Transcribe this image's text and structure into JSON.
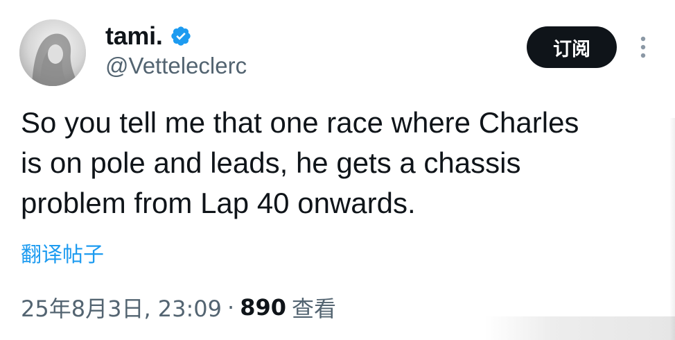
{
  "author": {
    "display_name": "tami.",
    "handle": "@Vetteleclerc",
    "verified": true,
    "avatar_icon": "avatar-portrait-icon",
    "verified_color": "#1d9bf0"
  },
  "actions": {
    "subscribe_label": "订阅",
    "more_icon": "more-vertical-icon"
  },
  "tweet": {
    "lines": [
      "So you tell me that one race where Charles",
      "is on pole and leads, he gets a chassis",
      "problem from Lap 40 onwards."
    ],
    "translate_label": "翻译帖子"
  },
  "meta": {
    "timestamp": "25年8月3日, 23:09",
    "separator": "·",
    "views_count": "890",
    "views_label": "查看"
  },
  "colors": {
    "text": "#0f1419",
    "secondary": "#536471",
    "accent": "#1d9bf0",
    "button_bg": "#0f1419"
  }
}
